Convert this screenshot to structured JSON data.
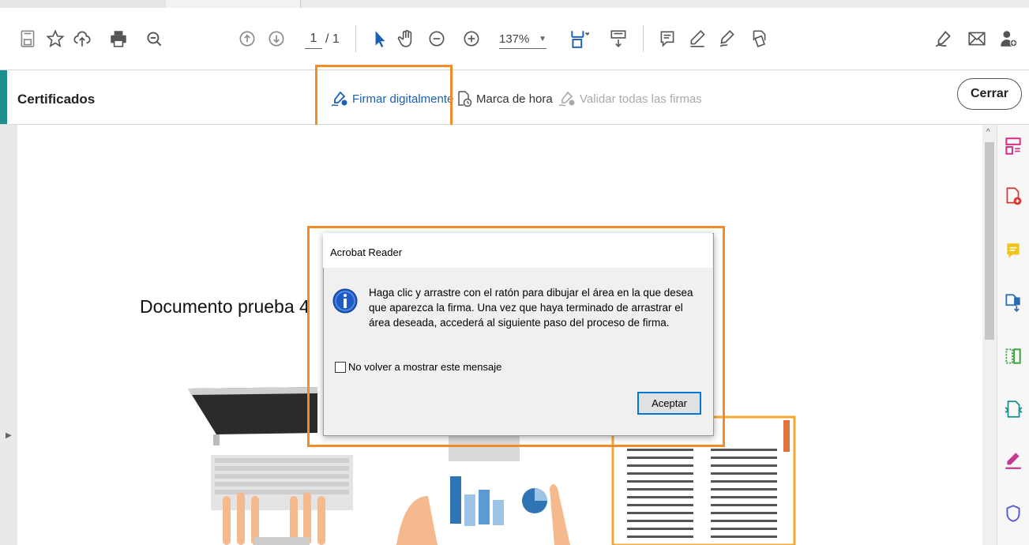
{
  "toolbar": {
    "page_current": "1",
    "page_total": "/ 1",
    "zoom": "137%"
  },
  "certbar": {
    "title": "Certificados",
    "sign_digitally": "Firmar digitalmente",
    "timestamp": "Marca de hora",
    "validate_all": "Validar todas las firmas",
    "close": "Cerrar"
  },
  "document": {
    "title": "Documento prueba 4"
  },
  "dialog": {
    "title": "Acrobat Reader",
    "message": "Haga clic y arrastre con el ratón para dibujar el área en la que desea que aparezca la firma. Una vez que haya terminado de arrastrar el área deseada, accederá al siguiente paso del proceso de firma.",
    "checkbox_label": "No volver a mostrar este mensaje",
    "ok": "Aceptar"
  },
  "colors": {
    "accent_teal": "#1e8e8e",
    "highlight_orange": "#f28c28",
    "sign_blue": "#1a5fb4"
  },
  "icons": {
    "toolbar_left": [
      "save-icon",
      "bookmark-star-icon",
      "upload-cloud-icon",
      "print-icon",
      "zoom-search-icon"
    ],
    "toolbar_nav": [
      "page-up-icon",
      "page-down-icon"
    ],
    "toolbar_tools": [
      "select-arrow-icon",
      "hand-icon",
      "zoom-out-icon",
      "zoom-in-icon"
    ],
    "toolbar_right": [
      "fit-page-icon",
      "scroll-mode-icon",
      "comment-icon",
      "highlight-pen-icon",
      "fill-sign-icon",
      "share-document-icon",
      "sign-icon",
      "email-icon",
      "add-user-icon"
    ],
    "right_panel": [
      "organize-pages-icon",
      "create-pdf-icon",
      "comment-tool-icon",
      "export-pdf-icon",
      "edit-pdf-icon",
      "compress-icon",
      "fill-sign-tool-icon",
      "protect-shield-icon"
    ]
  }
}
